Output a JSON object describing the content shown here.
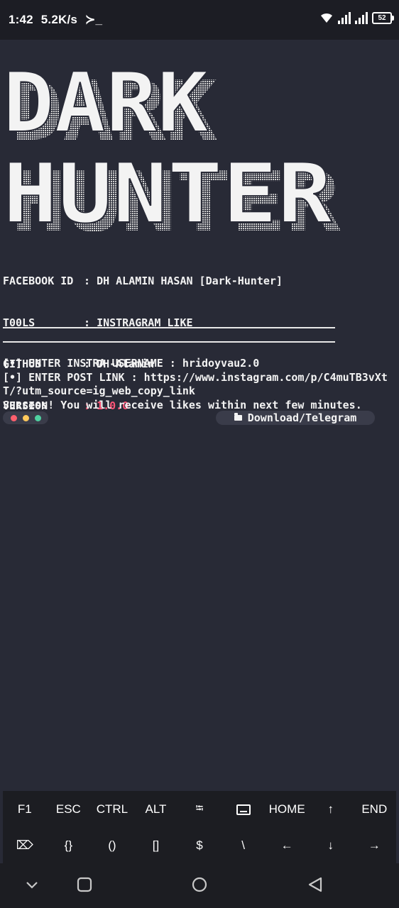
{
  "status_bar": {
    "time": "1:42",
    "speed": "5.2K/s",
    "terminal_glyph": "≻_",
    "battery": "52"
  },
  "banner": {
    "line1": "DARK",
    "line2": "HUNTER"
  },
  "info": [
    {
      "key": "FACEBOOK ID",
      "sep": ":",
      "value": "DH ALAMIN HASAN [Dark-Hunter]"
    },
    {
      "key": "T00LS",
      "sep": ":",
      "value": "INSTRAGRAM LIKE"
    },
    {
      "key": "GITHUB",
      "sep": ":",
      "value": "DH-Alamin"
    },
    {
      "key": "VERSION",
      "sep": ":",
      "value": "1.0.0"
    }
  ],
  "output": {
    "line1": "[•] ENTER INSTRA USERNAME : hridoyvau2.0",
    "line2": "[•] ENTER POST LINK : https://www.instagram.com/p/C4muTB3vXtT/?utm_source=ig_web_copy_link",
    "line3": "Success! You will receive likes within next few minutes."
  },
  "download_label": "Download/Telegram",
  "extra_keys": {
    "row1": [
      "F1",
      "ESC",
      "CTRL",
      "ALT",
      "⭾",
      "keyboard",
      "HOME",
      "↑",
      "END"
    ],
    "row2": [
      "⌦",
      "{}",
      "()",
      "[]",
      "$",
      "\\",
      "←",
      "↓",
      "→"
    ]
  },
  "colors": {
    "background": "#282a36",
    "version_accent": "#ff5577",
    "dot_red": "#ff5f6d",
    "dot_yellow": "#ffc95c",
    "dot_green": "#4fd1a1"
  }
}
